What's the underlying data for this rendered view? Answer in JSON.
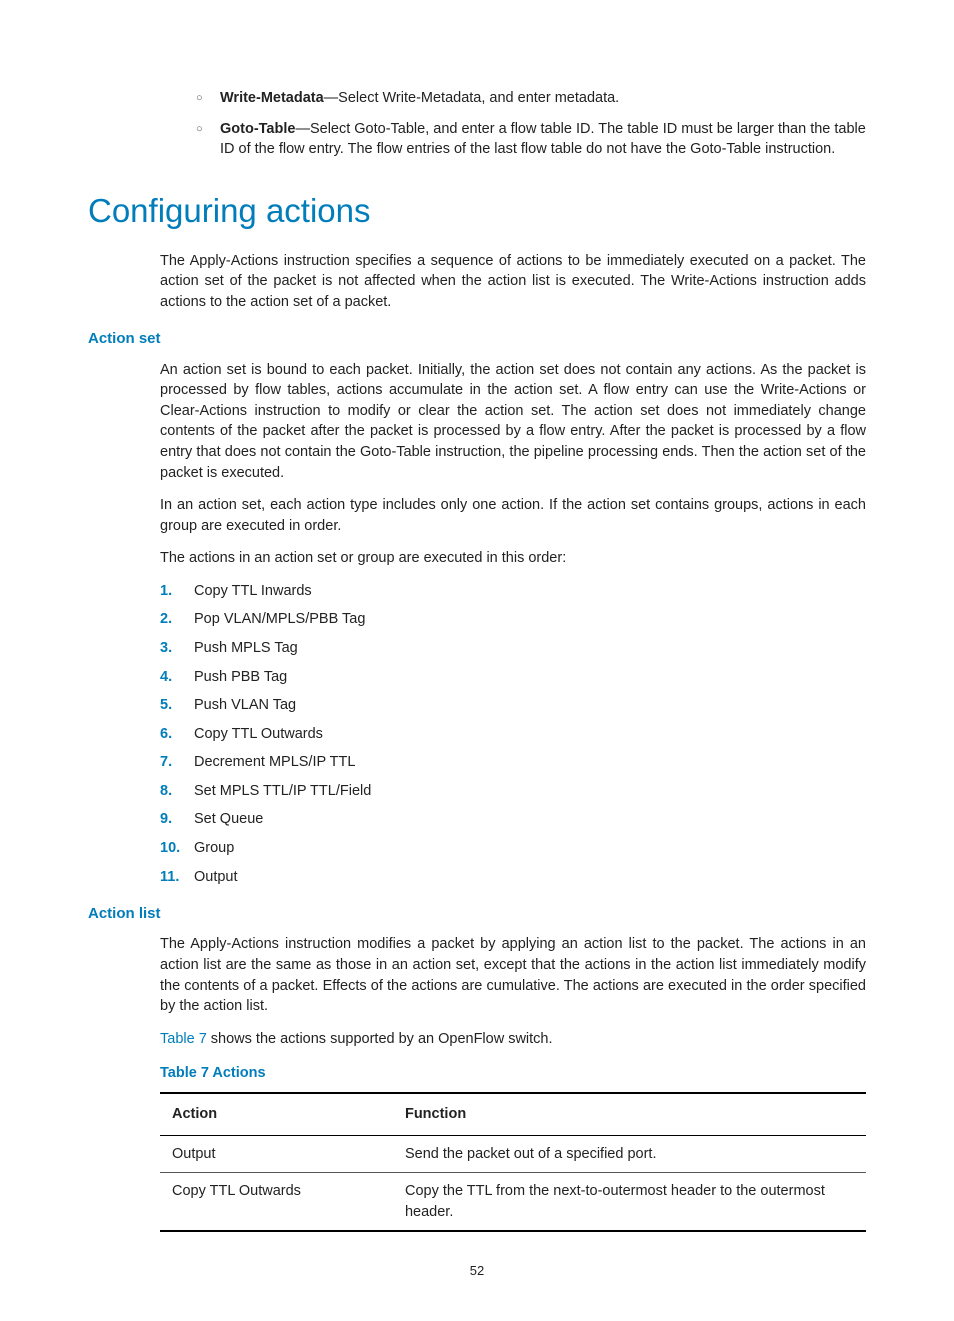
{
  "top_list": [
    {
      "term": "Write-Metadata",
      "desc": "—Select Write-Metadata, and enter metadata."
    },
    {
      "term": "Goto-Table",
      "desc": "—Select Goto-Table, and enter a flow table ID. The table ID must be larger than the table ID of the flow entry. The flow entries of the last flow table do not have the Goto-Table instruction."
    }
  ],
  "heading": "Configuring actions",
  "intro": "The Apply-Actions instruction specifies a sequence of actions to be immediately executed on a packet. The action set of the packet is not affected when the action list is executed. The Write-Actions instruction adds actions to the action set of a packet.",
  "action_set": {
    "title": "Action set",
    "p1": "An action set is bound to each packet. Initially, the action set does not contain any actions. As the packet is processed by flow tables, actions accumulate in the action set. A flow entry can use the Write-Actions or Clear-Actions instruction to modify or clear the action set. The action set does not immediately change contents of the packet after the packet is processed by a flow entry. After the packet is processed by a flow entry that does not contain the Goto-Table instruction, the pipeline processing ends. Then the action set of the packet is executed.",
    "p2": "In an action set, each action type includes only one action. If the action set contains groups, actions in each group are executed in order.",
    "p3": "The actions in an action set or group are executed in this order:",
    "items": [
      "Copy TTL Inwards",
      "Pop VLAN/MPLS/PBB Tag",
      "Push MPLS Tag",
      "Push PBB Tag",
      "Push VLAN Tag",
      "Copy TTL Outwards",
      "Decrement MPLS/IP TTL",
      "Set MPLS TTL/IP TTL/Field",
      "Set Queue",
      "Group",
      "Output"
    ]
  },
  "action_list": {
    "title": "Action list",
    "p1": "The Apply-Actions instruction modifies a packet by applying an action list to the packet. The actions in an action list are the same as those in an action set, except that the actions in the action list immediately modify the contents of a packet. Effects of the actions are cumulative. The actions are executed in the order specified by the action list.",
    "p2_link": "Table 7",
    "p2_rest": " shows the actions supported by an OpenFlow switch."
  },
  "table": {
    "caption": "Table 7 Actions",
    "headers": [
      "Action",
      "Function"
    ],
    "rows": [
      [
        "Output",
        "Send the packet out of a specified port."
      ],
      [
        "Copy TTL Outwards",
        "Copy the TTL from the next-to-outermost header to the outermost header."
      ]
    ]
  },
  "page": "52"
}
